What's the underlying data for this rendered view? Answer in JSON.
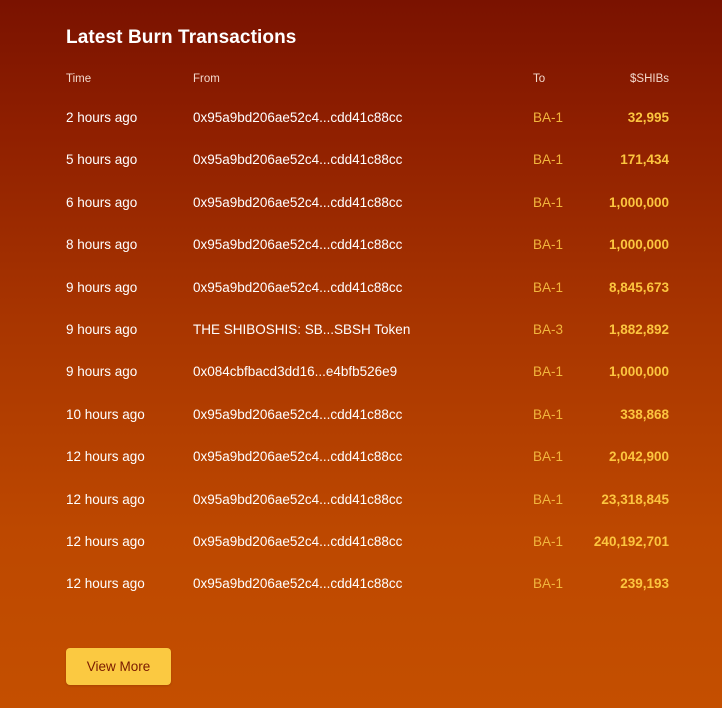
{
  "title": "Latest Burn Transactions",
  "columns": {
    "time": "Time",
    "from": "From",
    "to": "To",
    "amount": "$SHIBs"
  },
  "transactions": [
    {
      "time": "2 hours ago",
      "from": "0x95a9bd206ae52c4...cdd41c88cc",
      "to": "BA-1",
      "amount": "32,995"
    },
    {
      "time": "5 hours ago",
      "from": "0x95a9bd206ae52c4...cdd41c88cc",
      "to": "BA-1",
      "amount": "171,434"
    },
    {
      "time": "6 hours ago",
      "from": "0x95a9bd206ae52c4...cdd41c88cc",
      "to": "BA-1",
      "amount": "1,000,000"
    },
    {
      "time": "8 hours ago",
      "from": "0x95a9bd206ae52c4...cdd41c88cc",
      "to": "BA-1",
      "amount": "1,000,000"
    },
    {
      "time": "9 hours ago",
      "from": "0x95a9bd206ae52c4...cdd41c88cc",
      "to": "BA-1",
      "amount": "8,845,673"
    },
    {
      "time": "9 hours ago",
      "from": "THE SHIBOSHIS: SB...SBSH Token",
      "to": "BA-3",
      "amount": "1,882,892"
    },
    {
      "time": "9 hours ago",
      "from": "0x084cbfbacd3dd16...e4bfb526e9",
      "to": "BA-1",
      "amount": "1,000,000"
    },
    {
      "time": "10 hours ago",
      "from": "0x95a9bd206ae52c4...cdd41c88cc",
      "to": "BA-1",
      "amount": "338,868"
    },
    {
      "time": "12 hours ago",
      "from": "0x95a9bd206ae52c4...cdd41c88cc",
      "to": "BA-1",
      "amount": "2,042,900"
    },
    {
      "time": "12 hours ago",
      "from": "0x95a9bd206ae52c4...cdd41c88cc",
      "to": "BA-1",
      "amount": "23,318,845"
    },
    {
      "time": "12 hours ago",
      "from": "0x95a9bd206ae52c4...cdd41c88cc",
      "to": "BA-1",
      "amount": "240,192,701"
    },
    {
      "time": "12 hours ago",
      "from": "0x95a9bd206ae52c4...cdd41c88cc",
      "to": "BA-1",
      "amount": "239,193"
    }
  ],
  "view_more_label": "View More",
  "colors": {
    "background_top": "#7a1200",
    "background_bottom": "#c44f00",
    "accent": "#fbc941",
    "amount": "#fcc53f",
    "to_label": "#f2b63d"
  }
}
